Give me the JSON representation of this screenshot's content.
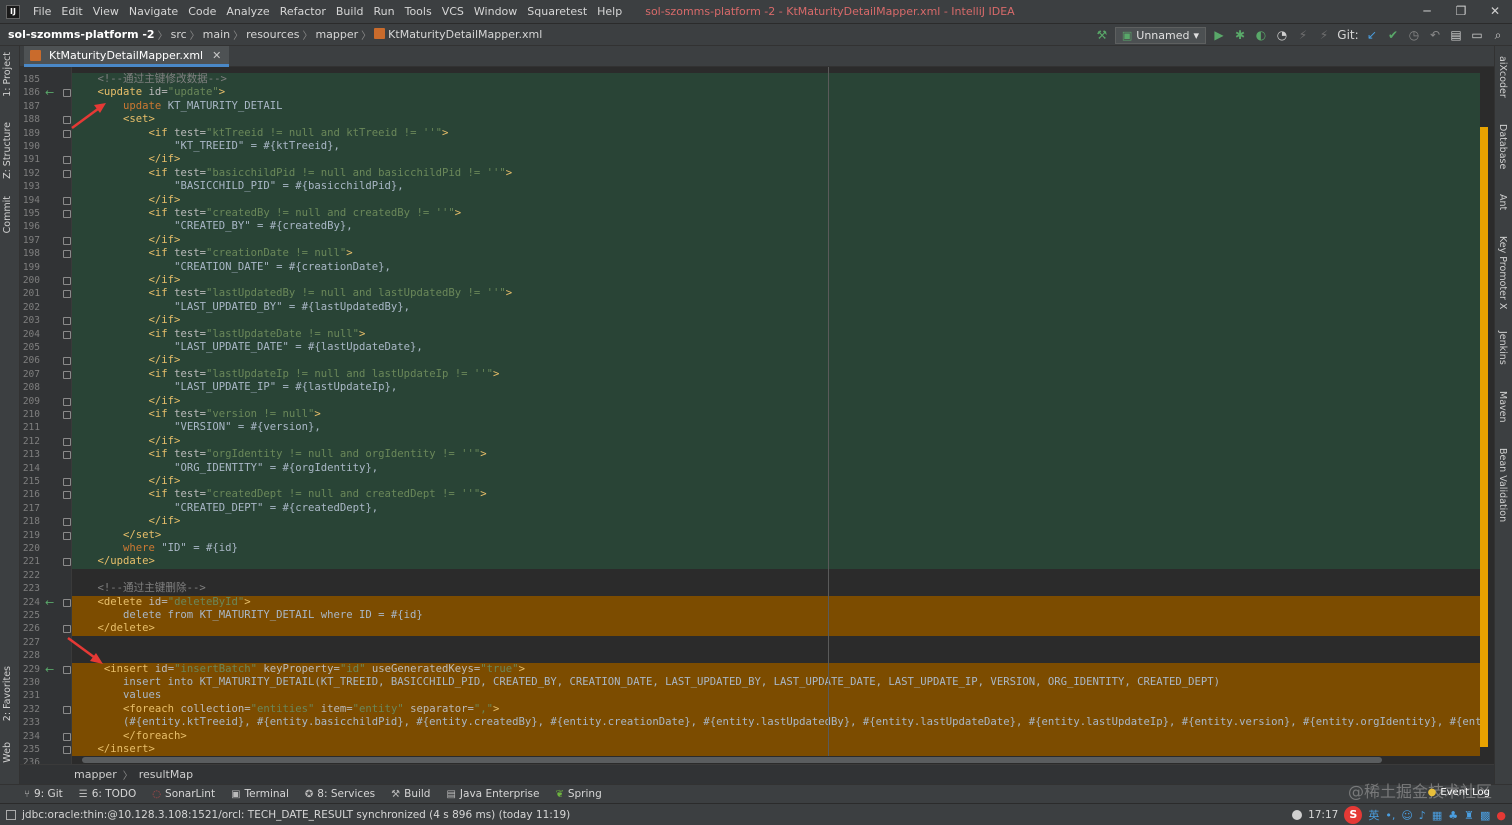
{
  "window": {
    "title": "sol-szomms-platform -2 - KtMaturityDetailMapper.xml - IntelliJ IDEA",
    "app_icon": "IJ",
    "controls": [
      "─",
      "❐",
      "✕"
    ]
  },
  "menu": [
    "File",
    "Edit",
    "View",
    "Navigate",
    "Code",
    "Analyze",
    "Refactor",
    "Build",
    "Run",
    "Tools",
    "VCS",
    "Window",
    "Squaretest",
    "Help"
  ],
  "breadcrumbs": [
    "sol-szomms-platform -2",
    "src",
    "main",
    "resources",
    "mapper",
    "KtMaturityDetailMapper.xml"
  ],
  "toolbar": {
    "run_config": "Unnamed",
    "git_label": "Git:"
  },
  "left_tools": [
    "1: Project",
    "Z: Structure",
    "Commit",
    "2: Favorites",
    "Web"
  ],
  "right_tools": [
    "aiXcoder",
    "Database",
    "Ant",
    "Key Promoter X",
    "Jenkins",
    "Maven",
    "Bean Validation"
  ],
  "tab": {
    "label": "KtMaturityDetailMapper.xml"
  },
  "code_lines": [
    {
      "n": "185",
      "hl": "green",
      "tokens": [
        {
          "t": "    "
        },
        {
          "t": "<!--通过主键修改数据-->",
          "c": "com"
        }
      ]
    },
    {
      "n": "186",
      "hl": "green",
      "change": true,
      "tokens": [
        {
          "t": "    "
        },
        {
          "t": "<update ",
          "c": "tag"
        },
        {
          "t": "id",
          "c": "attr"
        },
        {
          "t": "=",
          "c": "attr"
        },
        {
          "t": "\"update\"",
          "c": "val"
        },
        {
          "t": ">",
          "c": "tag"
        }
      ]
    },
    {
      "n": "187",
      "hl": "green",
      "tokens": [
        {
          "t": "        "
        },
        {
          "t": "update",
          "c": "sql"
        },
        {
          "t": " KT_MATURITY_DETAIL",
          "c": "txt"
        }
      ]
    },
    {
      "n": "188",
      "hl": "green",
      "tokens": [
        {
          "t": "        "
        },
        {
          "t": "<set>",
          "c": "tag"
        }
      ]
    },
    {
      "n": "189",
      "hl": "green",
      "tokens": [
        {
          "t": "            "
        },
        {
          "t": "<if ",
          "c": "tag"
        },
        {
          "t": "test",
          "c": "attr"
        },
        {
          "t": "=",
          "c": "attr"
        },
        {
          "t": "\"ktTreeid != null and ktTreeid != ''\"",
          "c": "val"
        },
        {
          "t": ">",
          "c": "tag"
        }
      ]
    },
    {
      "n": "190",
      "hl": "green",
      "tokens": [
        {
          "t": "                "
        },
        {
          "t": "\"KT_TREEID\" = #{ktTreeid},",
          "c": "txt"
        }
      ]
    },
    {
      "n": "191",
      "hl": "green",
      "tokens": [
        {
          "t": "            "
        },
        {
          "t": "</if>",
          "c": "tag"
        }
      ]
    },
    {
      "n": "192",
      "hl": "green",
      "tokens": [
        {
          "t": "            "
        },
        {
          "t": "<if ",
          "c": "tag"
        },
        {
          "t": "test",
          "c": "attr"
        },
        {
          "t": "=",
          "c": "attr"
        },
        {
          "t": "\"basicchildPid != null and basicchildPid != ''\"",
          "c": "val"
        },
        {
          "t": ">",
          "c": "tag"
        }
      ]
    },
    {
      "n": "193",
      "hl": "green",
      "tokens": [
        {
          "t": "                "
        },
        {
          "t": "\"BASICCHILD_PID\" = #{basicchildPid},",
          "c": "txt"
        }
      ]
    },
    {
      "n": "194",
      "hl": "green",
      "tokens": [
        {
          "t": "            "
        },
        {
          "t": "</if>",
          "c": "tag"
        }
      ]
    },
    {
      "n": "195",
      "hl": "green",
      "tokens": [
        {
          "t": "            "
        },
        {
          "t": "<if ",
          "c": "tag"
        },
        {
          "t": "test",
          "c": "attr"
        },
        {
          "t": "=",
          "c": "attr"
        },
        {
          "t": "\"createdBy != null and createdBy != ''\"",
          "c": "val"
        },
        {
          "t": ">",
          "c": "tag"
        }
      ]
    },
    {
      "n": "196",
      "hl": "green",
      "tokens": [
        {
          "t": "                "
        },
        {
          "t": "\"CREATED_BY\" = #{createdBy},",
          "c": "txt"
        }
      ]
    },
    {
      "n": "197",
      "hl": "green",
      "tokens": [
        {
          "t": "            "
        },
        {
          "t": "</if>",
          "c": "tag"
        }
      ]
    },
    {
      "n": "198",
      "hl": "green",
      "tokens": [
        {
          "t": "            "
        },
        {
          "t": "<if ",
          "c": "tag"
        },
        {
          "t": "test",
          "c": "attr"
        },
        {
          "t": "=",
          "c": "attr"
        },
        {
          "t": "\"creationDate != null\"",
          "c": "val"
        },
        {
          "t": ">",
          "c": "tag"
        }
      ]
    },
    {
      "n": "199",
      "hl": "green",
      "tokens": [
        {
          "t": "                "
        },
        {
          "t": "\"CREATION_DATE\" = #{creationDate},",
          "c": "txt"
        }
      ]
    },
    {
      "n": "200",
      "hl": "green",
      "tokens": [
        {
          "t": "            "
        },
        {
          "t": "</if>",
          "c": "tag"
        }
      ]
    },
    {
      "n": "201",
      "hl": "green",
      "tokens": [
        {
          "t": "            "
        },
        {
          "t": "<if ",
          "c": "tag"
        },
        {
          "t": "test",
          "c": "attr"
        },
        {
          "t": "=",
          "c": "attr"
        },
        {
          "t": "\"lastUpdatedBy != null and lastUpdatedBy != ''\"",
          "c": "val"
        },
        {
          "t": ">",
          "c": "tag"
        }
      ]
    },
    {
      "n": "202",
      "hl": "green",
      "tokens": [
        {
          "t": "                "
        },
        {
          "t": "\"LAST_UPDATED_BY\" = #{lastUpdatedBy},",
          "c": "txt"
        }
      ]
    },
    {
      "n": "203",
      "hl": "green",
      "tokens": [
        {
          "t": "            "
        },
        {
          "t": "</if>",
          "c": "tag"
        }
      ]
    },
    {
      "n": "204",
      "hl": "green",
      "tokens": [
        {
          "t": "            "
        },
        {
          "t": "<if ",
          "c": "tag"
        },
        {
          "t": "test",
          "c": "attr"
        },
        {
          "t": "=",
          "c": "attr"
        },
        {
          "t": "\"lastUpdateDate != null\"",
          "c": "val"
        },
        {
          "t": ">",
          "c": "tag"
        }
      ]
    },
    {
      "n": "205",
      "hl": "green",
      "tokens": [
        {
          "t": "                "
        },
        {
          "t": "\"LAST_UPDATE_DATE\" = #{lastUpdateDate},",
          "c": "txt"
        }
      ]
    },
    {
      "n": "206",
      "hl": "green",
      "tokens": [
        {
          "t": "            "
        },
        {
          "t": "</if>",
          "c": "tag"
        }
      ]
    },
    {
      "n": "207",
      "hl": "green",
      "tokens": [
        {
          "t": "            "
        },
        {
          "t": "<if ",
          "c": "tag"
        },
        {
          "t": "test",
          "c": "attr"
        },
        {
          "t": "=",
          "c": "attr"
        },
        {
          "t": "\"lastUpdateIp != null and lastUpdateIp != ''\"",
          "c": "val"
        },
        {
          "t": ">",
          "c": "tag"
        }
      ]
    },
    {
      "n": "208",
      "hl": "green",
      "tokens": [
        {
          "t": "                "
        },
        {
          "t": "\"LAST_UPDATE_IP\" = #{lastUpdateIp},",
          "c": "txt"
        }
      ]
    },
    {
      "n": "209",
      "hl": "green",
      "tokens": [
        {
          "t": "            "
        },
        {
          "t": "</if>",
          "c": "tag"
        }
      ]
    },
    {
      "n": "210",
      "hl": "green",
      "tokens": [
        {
          "t": "            "
        },
        {
          "t": "<if ",
          "c": "tag"
        },
        {
          "t": "test",
          "c": "attr"
        },
        {
          "t": "=",
          "c": "attr"
        },
        {
          "t": "\"version != null\"",
          "c": "val"
        },
        {
          "t": ">",
          "c": "tag"
        }
      ]
    },
    {
      "n": "211",
      "hl": "green",
      "tokens": [
        {
          "t": "                "
        },
        {
          "t": "\"VERSION\" = #{version},",
          "c": "txt"
        }
      ]
    },
    {
      "n": "212",
      "hl": "green",
      "tokens": [
        {
          "t": "            "
        },
        {
          "t": "</if>",
          "c": "tag"
        }
      ]
    },
    {
      "n": "213",
      "hl": "green",
      "tokens": [
        {
          "t": "            "
        },
        {
          "t": "<if ",
          "c": "tag"
        },
        {
          "t": "test",
          "c": "attr"
        },
        {
          "t": "=",
          "c": "attr"
        },
        {
          "t": "\"orgIdentity != null and orgIdentity != ''\"",
          "c": "val"
        },
        {
          "t": ">",
          "c": "tag"
        }
      ]
    },
    {
      "n": "214",
      "hl": "green",
      "tokens": [
        {
          "t": "                "
        },
        {
          "t": "\"ORG_IDENTITY\" = #{orgIdentity},",
          "c": "txt"
        }
      ]
    },
    {
      "n": "215",
      "hl": "green",
      "tokens": [
        {
          "t": "            "
        },
        {
          "t": "</if>",
          "c": "tag"
        }
      ]
    },
    {
      "n": "216",
      "hl": "green",
      "tokens": [
        {
          "t": "            "
        },
        {
          "t": "<if ",
          "c": "tag"
        },
        {
          "t": "test",
          "c": "attr"
        },
        {
          "t": "=",
          "c": "attr"
        },
        {
          "t": "\"createdDept != null and createdDept != ''\"",
          "c": "val"
        },
        {
          "t": ">",
          "c": "tag"
        }
      ]
    },
    {
      "n": "217",
      "hl": "green",
      "tokens": [
        {
          "t": "                "
        },
        {
          "t": "\"CREATED_DEPT\" = #{createdDept},",
          "c": "txt"
        }
      ]
    },
    {
      "n": "218",
      "hl": "green",
      "tokens": [
        {
          "t": "            "
        },
        {
          "t": "</if>",
          "c": "tag"
        }
      ]
    },
    {
      "n": "219",
      "hl": "green",
      "tokens": [
        {
          "t": "        "
        },
        {
          "t": "</set>",
          "c": "tag"
        }
      ]
    },
    {
      "n": "220",
      "hl": "green",
      "tokens": [
        {
          "t": "        "
        },
        {
          "t": "where",
          "c": "sql"
        },
        {
          "t": " \"ID\" = #{id}",
          "c": "txt"
        }
      ]
    },
    {
      "n": "221",
      "hl": "green",
      "tokens": [
        {
          "t": "    "
        },
        {
          "t": "</update>",
          "c": "tag"
        }
      ]
    },
    {
      "n": "222",
      "hl": "",
      "tokens": []
    },
    {
      "n": "223",
      "hl": "",
      "tokens": [
        {
          "t": "    "
        },
        {
          "t": "<!--通过主键删除-->",
          "c": "com"
        }
      ]
    },
    {
      "n": "224",
      "hl": "orange",
      "change": true,
      "tokens": [
        {
          "t": "    "
        },
        {
          "t": "<delete ",
          "c": "tag"
        },
        {
          "t": "id",
          "c": "attr"
        },
        {
          "t": "=",
          "c": "attr"
        },
        {
          "t": "\"deleteById\"",
          "c": "val"
        },
        {
          "t": ">",
          "c": "tag"
        }
      ]
    },
    {
      "n": "225",
      "hl": "orange",
      "tokens": [
        {
          "t": "        "
        },
        {
          "t": "delete from KT_MATURITY_DETAIL where ID = #{id}",
          "c": "txt"
        }
      ]
    },
    {
      "n": "226",
      "hl": "orange",
      "tokens": [
        {
          "t": "    "
        },
        {
          "t": "</delete>",
          "c": "tag"
        }
      ]
    },
    {
      "n": "227",
      "hl": "",
      "tokens": []
    },
    {
      "n": "228",
      "hl": "",
      "tokens": []
    },
    {
      "n": "229",
      "hl": "orange",
      "change": true,
      "tokens": [
        {
          "t": "     "
        },
        {
          "t": "<insert ",
          "c": "tag"
        },
        {
          "t": "id",
          "c": "attr"
        },
        {
          "t": "=",
          "c": "attr"
        },
        {
          "t": "\"insertBatch\"",
          "c": "val"
        },
        {
          "t": " keyProperty",
          "c": "attr"
        },
        {
          "t": "=",
          "c": "attr"
        },
        {
          "t": "\"id\"",
          "c": "val"
        },
        {
          "t": " useGeneratedKeys",
          "c": "attr"
        },
        {
          "t": "=",
          "c": "attr"
        },
        {
          "t": "\"true\"",
          "c": "val"
        },
        {
          "t": ">",
          "c": "tag"
        }
      ]
    },
    {
      "n": "230",
      "hl": "orange",
      "tokens": [
        {
          "t": "        "
        },
        {
          "t": "insert into KT_MATURITY_DETAIL(KT_TREEID, BASICCHILD_PID, CREATED_BY, CREATION_DATE, LAST_UPDATED_BY, LAST_UPDATE_DATE, LAST_UPDATE_IP, VERSION, ORG_IDENTITY, CREATED_DEPT)",
          "c": "txt"
        }
      ]
    },
    {
      "n": "231",
      "hl": "orange",
      "tokens": [
        {
          "t": "        "
        },
        {
          "t": "values",
          "c": "txt"
        }
      ]
    },
    {
      "n": "232",
      "hl": "orange",
      "tokens": [
        {
          "t": "        "
        },
        {
          "t": "<foreach ",
          "c": "tag"
        },
        {
          "t": "collection",
          "c": "attr"
        },
        {
          "t": "=",
          "c": "attr"
        },
        {
          "t": "\"entities\"",
          "c": "val"
        },
        {
          "t": " item",
          "c": "attr"
        },
        {
          "t": "=",
          "c": "attr"
        },
        {
          "t": "\"entity\"",
          "c": "val"
        },
        {
          "t": " separator",
          "c": "attr"
        },
        {
          "t": "=",
          "c": "attr"
        },
        {
          "t": "\",\"",
          "c": "val"
        },
        {
          "t": ">",
          "c": "tag"
        }
      ]
    },
    {
      "n": "233",
      "hl": "orange",
      "tokens": [
        {
          "t": "        "
        },
        {
          "t": "(#{entity.ktTreeid}, #{entity.basicchildPid}, #{entity.createdBy}, #{entity.creationDate}, #{entity.lastUpdatedBy}, #{entity.lastUpdateDate}, #{entity.lastUpdateIp}, #{entity.version}, #{entity.orgIdentity}, #{entity",
          "c": "txt"
        }
      ]
    },
    {
      "n": "234",
      "hl": "orange",
      "tokens": [
        {
          "t": "        "
        },
        {
          "t": "</foreach>",
          "c": "tag"
        }
      ]
    },
    {
      "n": "235",
      "hl": "orange",
      "tokens": [
        {
          "t": "    "
        },
        {
          "t": "</insert>",
          "c": "tag"
        }
      ]
    },
    {
      "n": "236",
      "hl": "",
      "tokens": []
    }
  ],
  "editor_breadcrumb": [
    "mapper",
    "resultMap"
  ],
  "tool_windows": [
    "9: Git",
    "6: TODO",
    "SonarLint",
    "Terminal",
    "8: Services",
    "Build",
    "Java Enterprise",
    "Spring"
  ],
  "status": {
    "message": "jdbc:oracle:thin:@10.128.3.108:1521/orcl: TECH_DATE_RESULT synchronized (4 s 896 ms) (today 11:19)",
    "clock": "17:17",
    "event_log": "Event Log",
    "watermark": "@稀土掘金技术社区",
    "ime": "英"
  },
  "colors": {
    "green_highlight": "#294436",
    "orange_highlight": "#7c4c00",
    "accent_scroll": "#e8a200",
    "arrow": "#e53935"
  }
}
